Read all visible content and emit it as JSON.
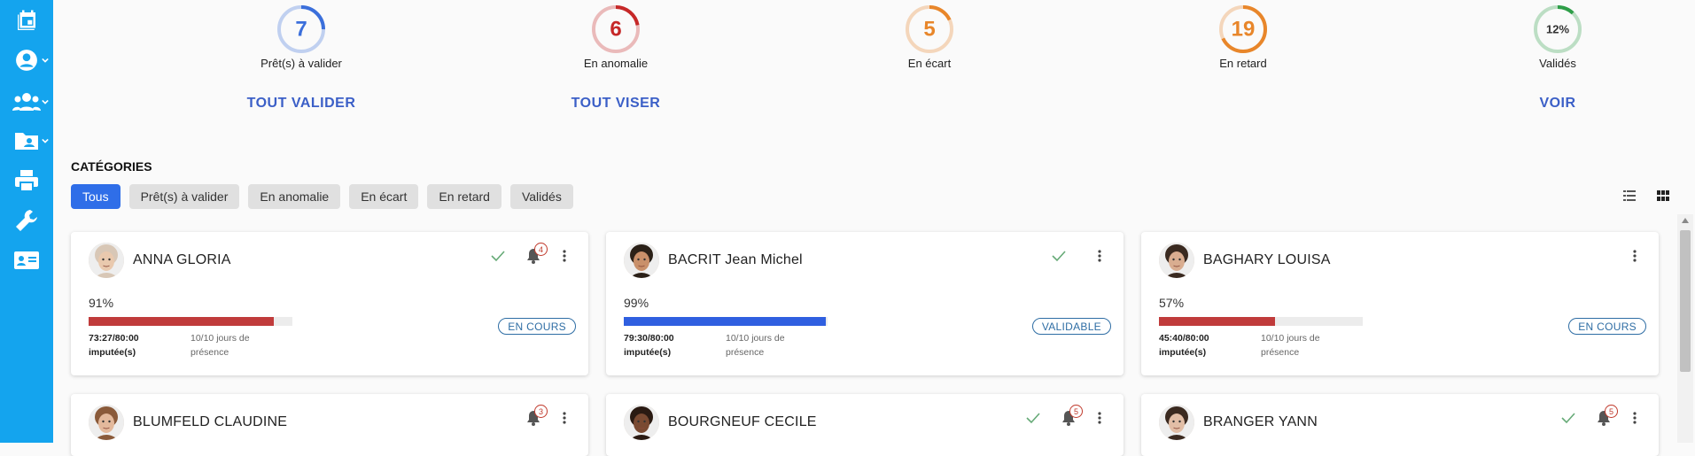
{
  "colors": {
    "sidebar": "#14a4ee",
    "blue": "#2f6ee8",
    "red": "#c03b3b",
    "orange": "#e8862a",
    "green": "#2e9e48",
    "link": "#3b5fc7"
  },
  "sidebar": {
    "items": [
      {
        "icon": "calendar-icon"
      },
      {
        "icon": "user-circle-icon"
      },
      {
        "icon": "users-icon"
      },
      {
        "icon": "folder-user-icon"
      },
      {
        "icon": "printer-icon"
      },
      {
        "icon": "wrench-icon"
      },
      {
        "icon": "id-card-icon"
      }
    ]
  },
  "stats": [
    {
      "value": "7",
      "label": "Prêt(s) à valider",
      "action": "TOUT VALIDER",
      "color": "#3b6fdb",
      "fraction": 0.25
    },
    {
      "value": "6",
      "label": "En anomalie",
      "action": "TOUT VISER",
      "color": "#c62828",
      "fraction": 0.22
    },
    {
      "value": "5",
      "label": "En écart",
      "action": "",
      "color": "#e8862a",
      "fraction": 0.18
    },
    {
      "value": "19",
      "label": "En retard",
      "action": "",
      "color": "#e8862a",
      "fraction": 0.68
    },
    {
      "value": "12%",
      "label": "Validés",
      "action": "VOIR",
      "color": "#2e9e48",
      "fraction": 0.12
    }
  ],
  "categories": {
    "title": "CATÉGORIES",
    "filters": [
      "Tous",
      "Prêt(s) à valider",
      "En anomalie",
      "En écart",
      "En retard",
      "Validés"
    ],
    "active": "Tous"
  },
  "cards": [
    {
      "name": "ANNA GLORIA",
      "percent": "91%",
      "progress": 0.91,
      "bar_color": "#c03b3b",
      "hours": "73:27/80:00",
      "hours_label": "imputée(s)",
      "presence": "10/10 jours de présence",
      "status": "EN COURS",
      "check": true,
      "bell_count": "4",
      "skin": "#e9c9ae",
      "hair": "#d8c7b6"
    },
    {
      "name": "BACRIT Jean Michel",
      "percent": "99%",
      "progress": 0.99,
      "bar_color": "#2f5fe0",
      "hours": "79:30/80:00",
      "hours_label": "imputée(s)",
      "presence": "10/10 jours de présence",
      "status": "VALIDABLE",
      "check": true,
      "bell_count": "",
      "skin": "#c9906a",
      "hair": "#2b2118"
    },
    {
      "name": "BAGHARY LOUISA",
      "percent": "57%",
      "progress": 0.57,
      "bar_color": "#c03b3b",
      "hours": "45:40/80:00",
      "hours_label": "imputée(s)",
      "presence": "10/10 jours de présence",
      "status": "EN COURS",
      "check": false,
      "bell_count": "",
      "skin": "#d9ad90",
      "hair": "#3a2a20"
    },
    {
      "name": "BLUMFELD CLAUDINE",
      "check": false,
      "bell_count": "3",
      "skin": "#e3b99c",
      "hair": "#8a5a3a"
    },
    {
      "name": "BOURGNEUF CECILE",
      "check": true,
      "bell_count": "5",
      "skin": "#7a4a32",
      "hair": "#2a1a12"
    },
    {
      "name": "BRANGER YANN",
      "check": true,
      "bell_count": "5",
      "skin": "#e2bea6",
      "hair": "#3b2a20"
    }
  ]
}
